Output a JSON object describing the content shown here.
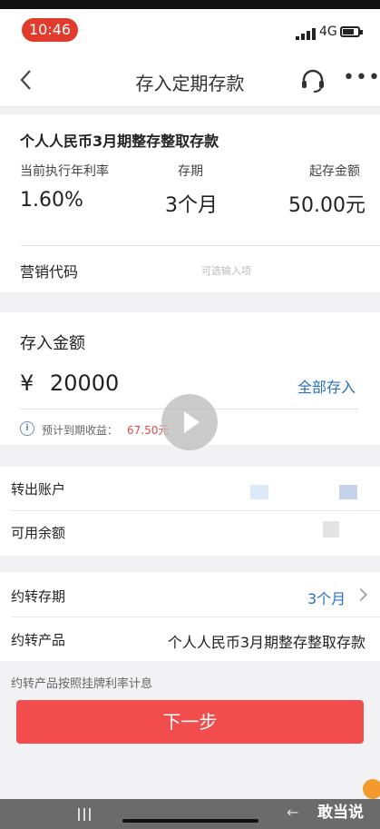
{
  "status_bar": {
    "time": "10:46",
    "network": "4G"
  },
  "nav": {
    "title": "存入定期存款"
  },
  "product": {
    "name": "个人人民币3月期整存整取存款",
    "rate_label": "当前执行年利率",
    "rate_value": "1.60%",
    "term_label": "存期",
    "term_value": "3个月",
    "min_label": "起存金额",
    "min_value": "50.00元",
    "promo_label": "营销代码",
    "promo_placeholder": "可选输入项"
  },
  "amount": {
    "title": "存入金额",
    "currency": "¥",
    "value": "20000",
    "deposit_all": "全部存入",
    "expect_label": "预计到期收益：",
    "expect_value": "67.50元"
  },
  "account": {
    "out_label": "转出账户",
    "balance_label": "可用余额"
  },
  "rollover": {
    "term_label": "约转存期",
    "term_value": "3个月",
    "product_label": "约转产品",
    "product_value": "个人人民币3月期整存整取存款",
    "note": "约转产品按照挂牌利率计息"
  },
  "next_button": "下一步",
  "watermark": "敢当说",
  "colors": {
    "accent_red": "#f24d4d",
    "link_blue": "#2b6fc2",
    "time_pill": "#e03b2c"
  }
}
